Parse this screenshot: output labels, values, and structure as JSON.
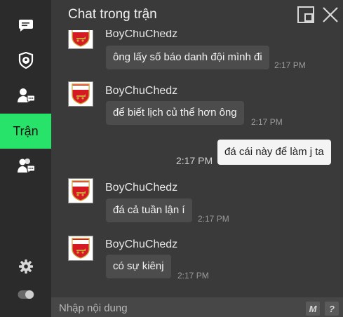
{
  "window": {
    "title": "Chat trong trận"
  },
  "sidebar": {
    "items": [
      {
        "icon": "chat-bubble-icon",
        "label": ""
      },
      {
        "icon": "shield-ball-icon",
        "label": ""
      },
      {
        "icon": "person-chat-icon",
        "label": ""
      },
      {
        "icon": "",
        "label": "Trận",
        "active": true
      },
      {
        "icon": "group-chat-icon",
        "label": ""
      }
    ],
    "settings_icon": "gear-icon",
    "toggle_icon": "toggle-icon"
  },
  "messages": [
    {
      "sender": "BoyChuChedz",
      "text": "ông lấy số báo danh đội mình đi",
      "time": "2:17 PM",
      "mine": false
    },
    {
      "sender": "BoyChuChedz",
      "text": "để biết lịch củ thể hơn ông",
      "time": "2:17 PM",
      "mine": false
    },
    {
      "sender": "",
      "text": "đá cái này để làm j ta",
      "time": "2:17 PM",
      "mine": true
    },
    {
      "sender": "BoyChuChedz",
      "text": "đá cả tuần lận í",
      "time": "2:17 PM",
      "mine": false
    },
    {
      "sender": "BoyChuChedz",
      "text": "có sự kiênj",
      "time": "2:17 PM",
      "mine": false
    }
  ],
  "input": {
    "placeholder": "Nhập nội dung",
    "value": ""
  },
  "buttons": {
    "macro_label": "M",
    "help_label": "?"
  },
  "colors": {
    "accent": "#27e36a",
    "background": "#3a3a3a",
    "sidebar": "#2b2b2b"
  }
}
